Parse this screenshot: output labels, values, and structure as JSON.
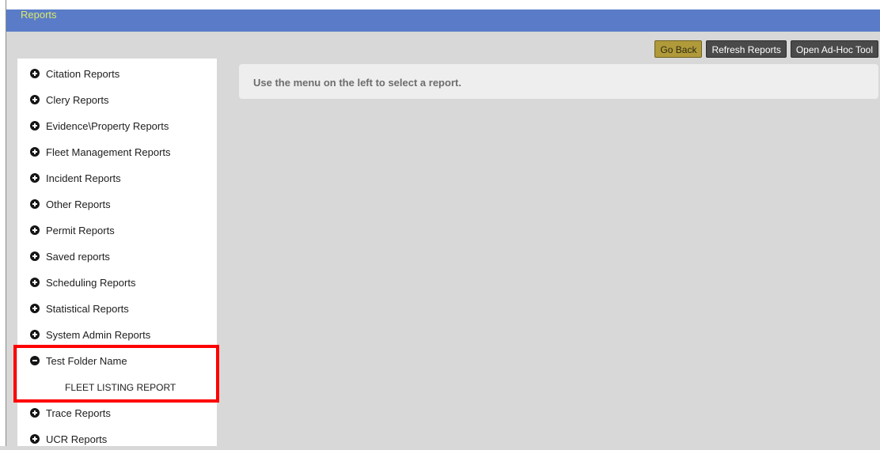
{
  "header": {
    "title": "Reports"
  },
  "toolbar": {
    "go_back": "Go Back",
    "refresh": "Refresh Reports",
    "adhoc": "Open Ad-Hoc Tool"
  },
  "sidebar": {
    "items": [
      {
        "label": "Citation Reports",
        "icon": "plus-circle-icon"
      },
      {
        "label": "Clery Reports",
        "icon": "plus-circle-icon"
      },
      {
        "label": "Evidence\\Property Reports",
        "icon": "plus-circle-icon"
      },
      {
        "label": "Fleet Management Reports",
        "icon": "plus-circle-icon"
      },
      {
        "label": "Incident Reports",
        "icon": "plus-circle-icon"
      },
      {
        "label": "Other Reports",
        "icon": "plus-circle-icon"
      },
      {
        "label": "Permit Reports",
        "icon": "plus-circle-icon"
      },
      {
        "label": "Saved reports",
        "icon": "plus-circle-icon"
      },
      {
        "label": "Scheduling Reports",
        "icon": "plus-circle-icon"
      },
      {
        "label": "Statistical Reports",
        "icon": "plus-circle-icon"
      },
      {
        "label": "System Admin Reports",
        "icon": "plus-circle-icon"
      },
      {
        "label": "Test Folder Name",
        "icon": "minus-circle-icon",
        "expanded": true,
        "children": [
          {
            "label": "FLEET LISTING REPORT"
          }
        ]
      },
      {
        "label": "Trace Reports",
        "icon": "plus-circle-icon"
      },
      {
        "label": "UCR Reports",
        "icon": "plus-circle-icon"
      }
    ]
  },
  "main": {
    "message": "Use the menu on the left to select a report."
  },
  "colors": {
    "topbar": "#5a7cc8",
    "title": "#d9e86a",
    "go_back": "#b09a3a",
    "buttons": "#4a4a4a",
    "highlight": "#ff0000",
    "background": "#d8d8d8"
  }
}
